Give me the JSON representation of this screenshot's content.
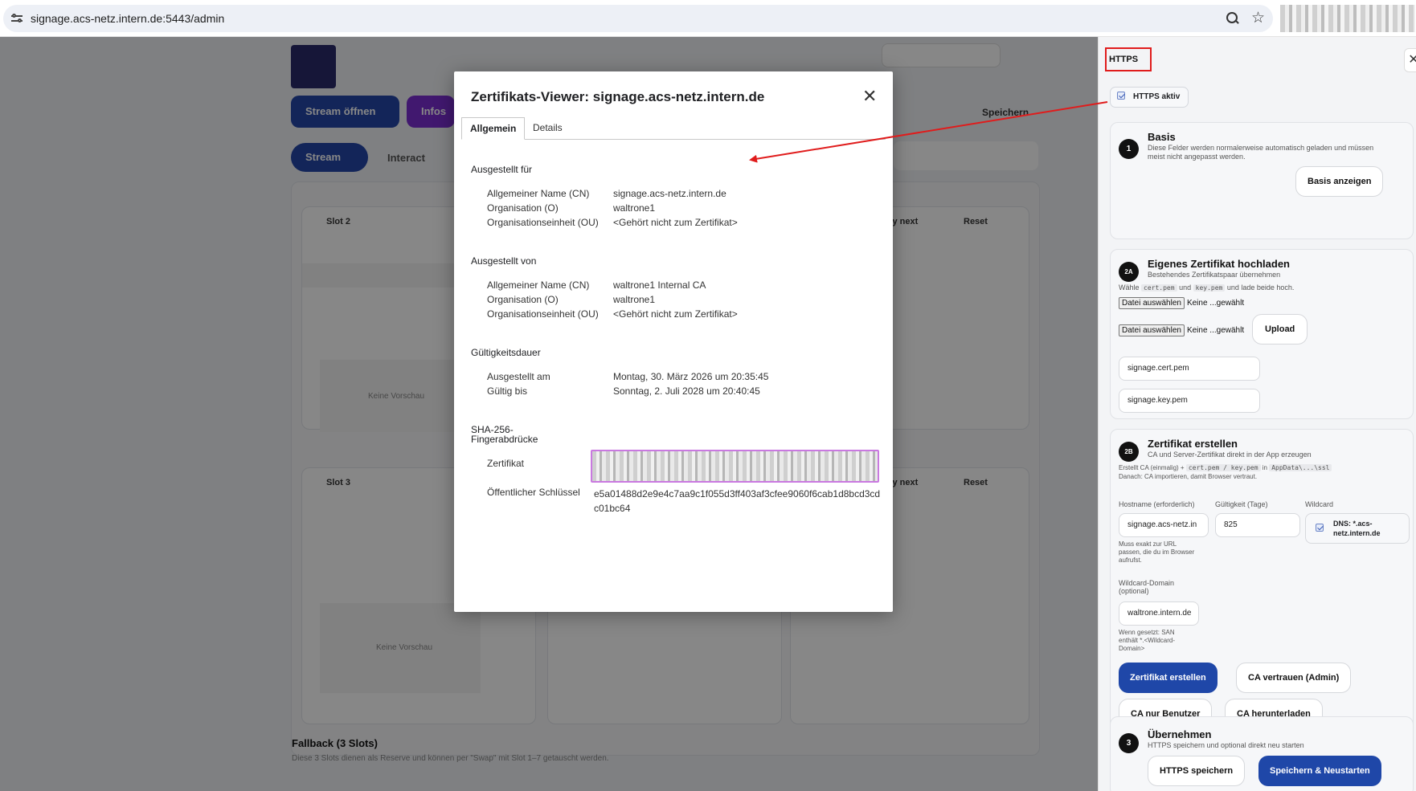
{
  "browser": {
    "url": "signage.acs-netz.intern.de:5443/admin"
  },
  "background": {
    "btn_stream_open": "Stream öffnen",
    "btn_info": "Infos",
    "tab_stream": "Stream",
    "tab_interact": "Interact",
    "save": "Speichern",
    "slot2": "Slot 2",
    "slot3": "Slot 3",
    "play_next": "Play next",
    "reset": "Reset",
    "no_preview": "Keine Vorschau",
    "fallback_title": "Fallback (3 Slots)",
    "fallback_desc": "Diese 3 Slots dienen als Reserve und können per \"Swap\" mit Slot 1–7 getauscht werden."
  },
  "dialog": {
    "title": "Zertifikats-Viewer: signage.acs-netz.intern.de",
    "tabs": [
      {
        "label": "Allgemein"
      },
      {
        "label": "Details"
      }
    ],
    "issued_to": {
      "heading": "Ausgestellt für",
      "rows": [
        {
          "label": "Allgemeiner Name (CN)",
          "value": "signage.acs-netz.intern.de"
        },
        {
          "label": "Organisation (O)",
          "value": "waltrone1"
        },
        {
          "label": "Organisationseinheit (OU)",
          "value": "<Gehört nicht zum Zertifikat>"
        }
      ]
    },
    "issued_by": {
      "heading": "Ausgestellt von",
      "rows": [
        {
          "label": "Allgemeiner Name (CN)",
          "value": "waltrone1 Internal CA"
        },
        {
          "label": "Organisation (O)",
          "value": "waltrone1"
        },
        {
          "label": "Organisationseinheit (OU)",
          "value": "<Gehört nicht zum Zertifikat>"
        }
      ]
    },
    "validity": {
      "heading": "Gültigkeitsdauer",
      "rows": [
        {
          "label": "Ausgestellt am",
          "value": "Montag, 30. März 2026 um 20:35:45"
        },
        {
          "label": "Gültig bis",
          "value": "Sonntag, 2. Juli 2028 um 20:40:45"
        }
      ]
    },
    "fingerprints": {
      "heading_line1": "SHA-256-",
      "heading_line2": "Fingerabdrücke",
      "cert_label": "Zertifikat",
      "pubkey_label": "Öffentlicher Schlüssel",
      "pubkey_line1": "e5a01488d2e9e4c7aa9c1f055d3ff403af3cfee9060f6cab1d8bcd3cd",
      "pubkey_line2": "c01bc64"
    }
  },
  "sidebar": {
    "title": "HTTPS",
    "https_active": "HTTPS aktiv",
    "basis": {
      "num": "1",
      "title": "Basis",
      "desc1": "Diese Felder werden normalerweise automatisch geladen und müssen",
      "desc2": "meist nicht angepasst werden.",
      "button": "Basis anzeigen"
    },
    "upload": {
      "num": "2A",
      "title": "Eigenes Zertifikat hochladen",
      "desc": "Bestehendes Zertifikatspaar übernehmen",
      "hint_pre": "Wähle",
      "hint_cert": "cert.pem",
      "hint_and": "und",
      "hint_key": "key.pem",
      "hint_post": "und lade beide hoch.",
      "file_button": "Datei auswählen",
      "file_status": "Keine ...gewählt",
      "upload_button": "Upload",
      "cert_file": "signage.cert.pem",
      "key_file": "signage.key.pem"
    },
    "create": {
      "num": "2B",
      "title": "Zertifikat erstellen",
      "desc": "CA und Server-Zertifikat direkt in der App erzeugen",
      "info_pre": "Erstellt CA (einmalig) +",
      "info_code1": "cert.pem / key.pem",
      "info_in": "in",
      "info_code2": "AppData\\...\\ssl",
      "info_line2": "Danach: CA importieren, damit Browser vertraut.",
      "hostname_label": "Hostname (erforderlich)",
      "hostname_value": "signage.acs-netz.in",
      "validity_label": "Gültigkeit (Tage)",
      "validity_value": "825",
      "wildcard_label": "Wildcard",
      "wildcard_chip1": "DNS: *.acs-",
      "wildcard_chip2": "netz.intern.de",
      "host_hint1": "Muss exakt zur URL",
      "host_hint2": "passen, die du im Browser",
      "host_hint3": "aufrufst.",
      "wildcard_domain_label1": "Wildcard-Domain",
      "wildcard_domain_label2": "(optional)",
      "wildcard_domain_value": "waltrone.intern.de",
      "wd_hint1": "Wenn gesetzt: SAN",
      "wd_hint2": "enthält *.<Wildcard-",
      "wd_hint3": "Domain>",
      "btn_create": "Zertifikat erstellen",
      "btn_trust_admin": "CA vertrauen (Admin)",
      "btn_user_only": "CA nur Benutzer",
      "btn_download": "CA herunterladen"
    },
    "apply": {
      "num": "3",
      "title": "Übernehmen",
      "desc": "HTTPS speichern und optional direkt neu starten",
      "btn_save": "HTTPS speichern",
      "btn_save_restart": "Speichern & Neustarten"
    }
  },
  "colors": {
    "annotation": "#e01c1c",
    "primary": "#1f47a8",
    "highlight": "#c979e0"
  }
}
